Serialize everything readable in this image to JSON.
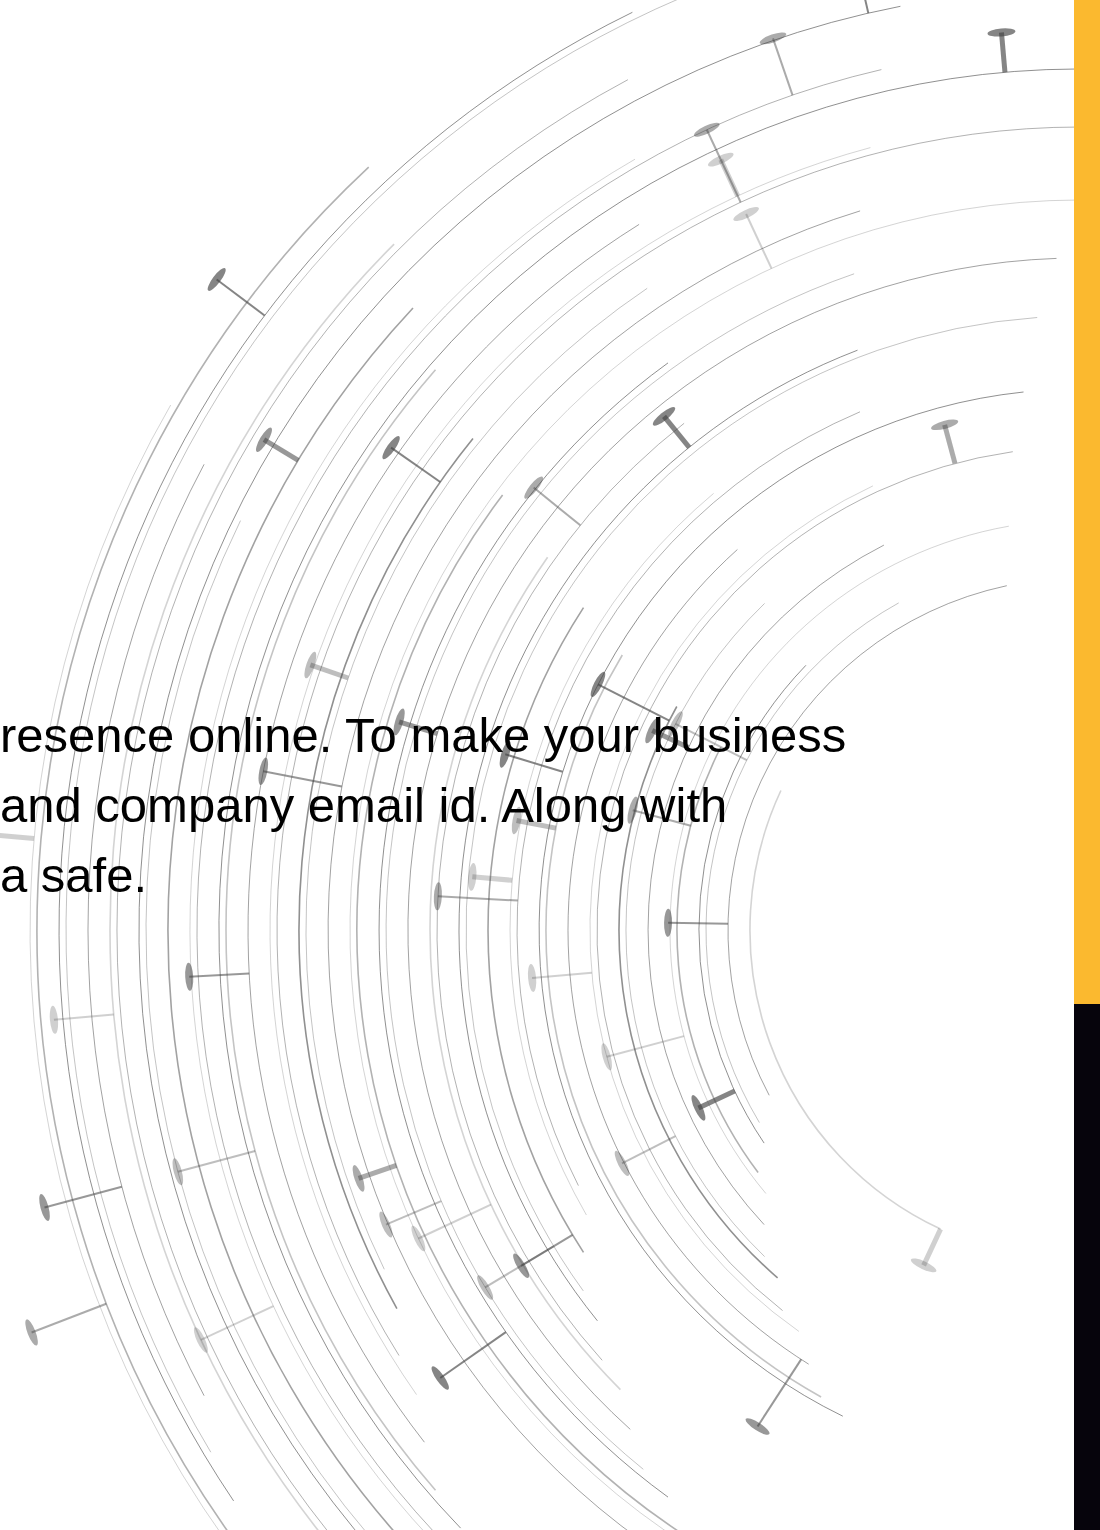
{
  "paragraph": {
    "lines": [
      "resence online. To make your business",
      "and company email id. Along with",
      "a safe."
    ]
  },
  "side_bar": {
    "segments": [
      {
        "color": "#fbb92f"
      },
      {
        "color": "#06040c"
      }
    ]
  }
}
